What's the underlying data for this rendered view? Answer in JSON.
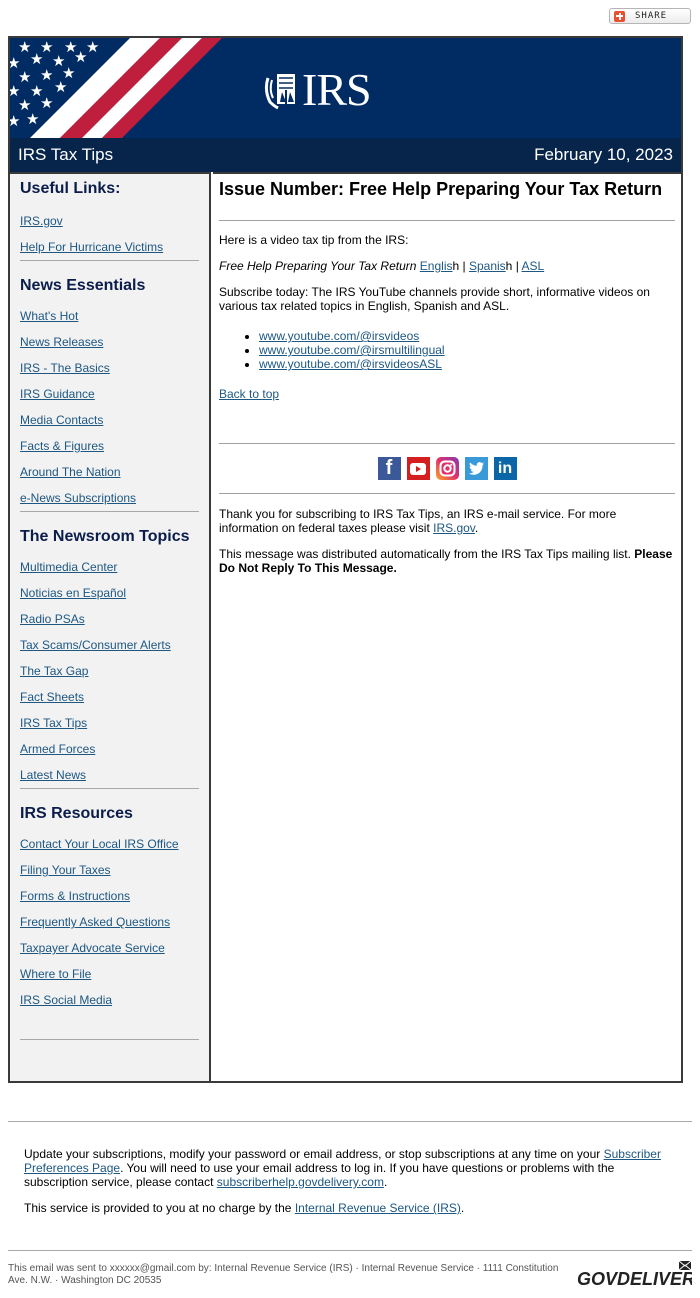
{
  "share": {
    "label": "SHARE"
  },
  "banner": {
    "logo_text": "IRS"
  },
  "titlebar": {
    "title": "IRS Tax Tips",
    "date": "February 10, 2023"
  },
  "sidebar": {
    "sections": [
      {
        "heading": "Useful Links:",
        "links": [
          "IRS.gov",
          "Help For Hurricane Victims"
        ]
      },
      {
        "heading": "News Essentials",
        "links": [
          "What's Hot",
          "News Releases",
          "IRS - The Basics",
          "IRS Guidance",
          "Media Contacts",
          "Facts & Figures",
          "Around The Nation",
          "e-News Subscriptions"
        ]
      },
      {
        "heading": "The Newsroom Topics",
        "links": [
          "Multimedia Center",
          "Noticias en Español",
          "Radio PSAs",
          "Tax Scams/Consumer Alerts",
          "The Tax Gap",
          "Fact Sheets",
          "IRS Tax Tips",
          "Armed Forces",
          "Latest News"
        ]
      },
      {
        "heading": "IRS Resources",
        "links": [
          "Contact Your Local IRS Office",
          "Filing Your Taxes",
          "Forms & Instructions",
          "Frequently Asked Questions",
          "Taxpayer Advocate Service",
          "Where to File",
          "IRS Social Media"
        ]
      }
    ]
  },
  "main": {
    "title": "Issue Number:  Free Help Preparing Your Tax Return",
    "intro": "Here is a video tax tip from the IRS:",
    "video_title": "Free Help Preparing Your Tax Return",
    "video_links": {
      "english_link": "Englis",
      "english_tail": "h",
      "sep1": " | ",
      "spanish_link": "Spanis",
      "spanish_tail": "h",
      "sep2": " | ",
      "asl_link": "ASL"
    },
    "subscribe_text": "Subscribe today: The IRS YouTube channels provide short, informative videos on various tax related topics in English, Spanish and ASL.",
    "youtube_links": [
      "www.youtube.com/@irsvideos",
      "www.youtube.com/@irsmultilingual",
      "www.youtube.com/@irsvideosASL"
    ],
    "back_to_top": "Back to top",
    "social_icons": [
      {
        "name": "facebook-icon",
        "glyph": "f",
        "color": "#3b5998"
      },
      {
        "name": "youtube-icon",
        "glyph": "▶",
        "color": "#d31f1f"
      },
      {
        "name": "instagram-icon",
        "glyph": "◎",
        "color": "#c13584"
      },
      {
        "name": "twitter-icon",
        "glyph": "🐦",
        "color": "#3a9ad9"
      },
      {
        "name": "linkedin-icon",
        "glyph": "in",
        "color": "#0a66a6"
      }
    ],
    "thanks_pre": "Thank you for subscribing to IRS Tax Tips, an IRS e-mail service. For more information on federal taxes please visit ",
    "thanks_link": "IRS.gov",
    "thanks_post": ".",
    "auto_msg": "This message was distributed automatically from the IRS Tax Tips mailing list. ",
    "auto_msg_bold": "Please Do Not Reply To This Message."
  },
  "footer": {
    "update_pre": "Update your subscriptions, modify your password or email address, or stop subscriptions at any time on your ",
    "prefs_link": "Subscriber Preferences Page",
    "update_mid": ". You will need to use your email address to log in. If you have questions or problems with the subscription service, please contact ",
    "help_link": "subscriberhelp.govdelivery.com",
    "update_post": ".",
    "service_pre": "This service is provided to you at no charge by the ",
    "service_link": "Internal Revenue Service (IRS)",
    "service_post": ".",
    "fineprint": "This email was sent to xxxxxx@gmail.com by: Internal Revenue Service (IRS) · Internal Revenue Service · 1111 Constitution Ave. N.W. · Washington DC 20535",
    "brand": "GOVDELIVERY"
  }
}
